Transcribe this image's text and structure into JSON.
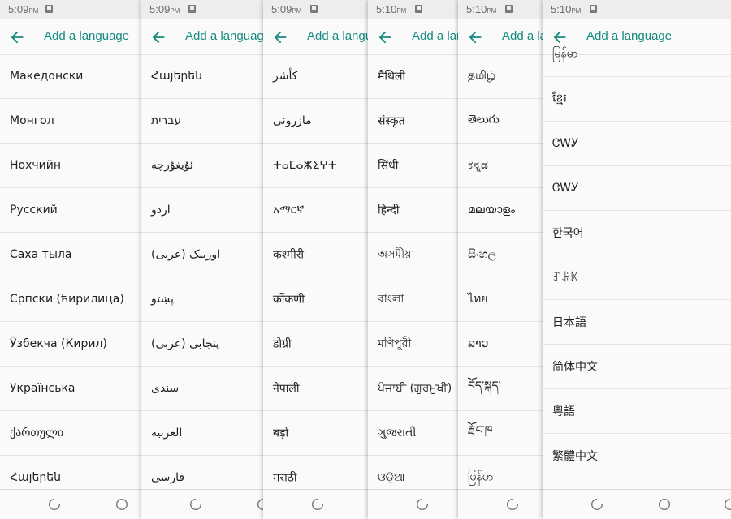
{
  "app": {
    "title": "Add a language",
    "accent_color": "#158b80",
    "back_icon": "arrow-back-icon",
    "status_icon": "sim-card-icon"
  },
  "panels": [
    {
      "time": "5:09",
      "period": "PM",
      "items": [
        "Македонски",
        "Монгол",
        "Нохчийн",
        "Русский",
        "Саха тыла",
        "Српски (ћирилица)",
        "Ўзбекча (Кирил)",
        "Українська",
        "ქართული",
        "Հայերեն"
      ]
    },
    {
      "time": "5:09",
      "period": "PM",
      "items": [
        "Հայերեն",
        "עברית",
        "ئۇيغۇرچە",
        "اردو",
        "اوزبیک (عربی)",
        "پښتو",
        "پنجابی (عربی)",
        "سندی",
        "العربية",
        "فارسی"
      ]
    },
    {
      "time": "5:09",
      "period": "PM",
      "items": [
        "کأشر",
        "مازرونی",
        "ⵜⴰⵎⴰⵣⵉⵖⵜ",
        "አማርኛ",
        "कश्मीरी",
        "कोंकणी",
        "डोग्री",
        "नेपाली",
        "बड़ो",
        "मराठी"
      ]
    },
    {
      "time": "5:10",
      "period": "PM",
      "items": [
        "मैथिली",
        "संस्कृत",
        "सिंधी",
        "हिन्दी",
        "অসমীয়া",
        "বাংলা",
        "মণিপুরী",
        "ਪੰਜਾਬੀ (ਗੁਰਮੁਖੀ)",
        "ગુજરાતી",
        "ଓଡ଼ିଆ"
      ]
    },
    {
      "time": "5:10",
      "period": "PM",
      "items": [
        "தமிழ்",
        "తెలుగు",
        "ಕನ್ನಡ",
        "മലയാളം",
        "සිංහල",
        "ไทย",
        "ລາວ",
        "བོད་སྐད་",
        "རྫོང་ཁ",
        "မြန်မာ"
      ]
    },
    {
      "time": "5:10",
      "period": "PM",
      "items": [
        "မြန်မာ",
        "ខ្មែរ",
        "ᏣᎳᎩ",
        "ᏣᎳᎩ",
        "한국어",
        "ꆈꌠꉙ",
        "日本語",
        "简体中文",
        "粵語",
        "繁體中文"
      ]
    }
  ],
  "nav": {
    "recents_icon": "recents-icon",
    "home_icon": "home-icon"
  }
}
